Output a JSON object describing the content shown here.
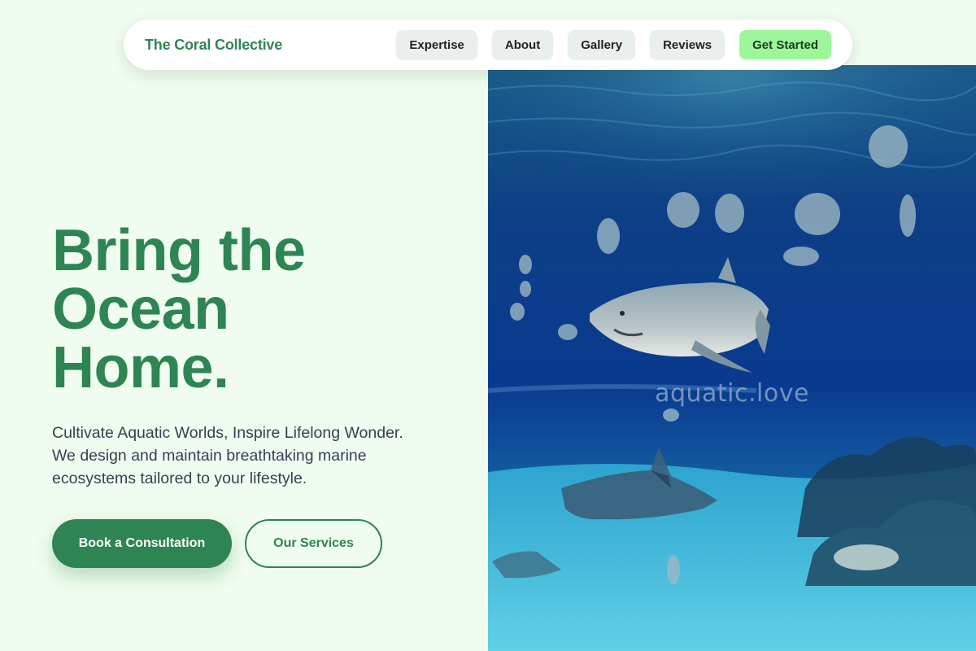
{
  "nav": {
    "brand": "The Coral Collective",
    "links": [
      "Expertise",
      "About",
      "Gallery",
      "Reviews"
    ],
    "cta_label": "Get Started"
  },
  "hero": {
    "headline": [
      "Bring the",
      "Ocean",
      "Home."
    ],
    "subtext": "Cultivate Aquatic Worlds, Inspire Lifelong Wonder. We design and maintain breathtaking marine ecosystems tailored to your lifestyle.",
    "primary_button": "Book a Consultation",
    "secondary_button": "Our Services"
  },
  "image": {
    "watermark": "aquatic.love"
  },
  "colors": {
    "brand_green": "#2e8553",
    "cta_green": "#9cf79a",
    "page_background": "#effcef",
    "nav_button_bg": "#e9efec"
  }
}
